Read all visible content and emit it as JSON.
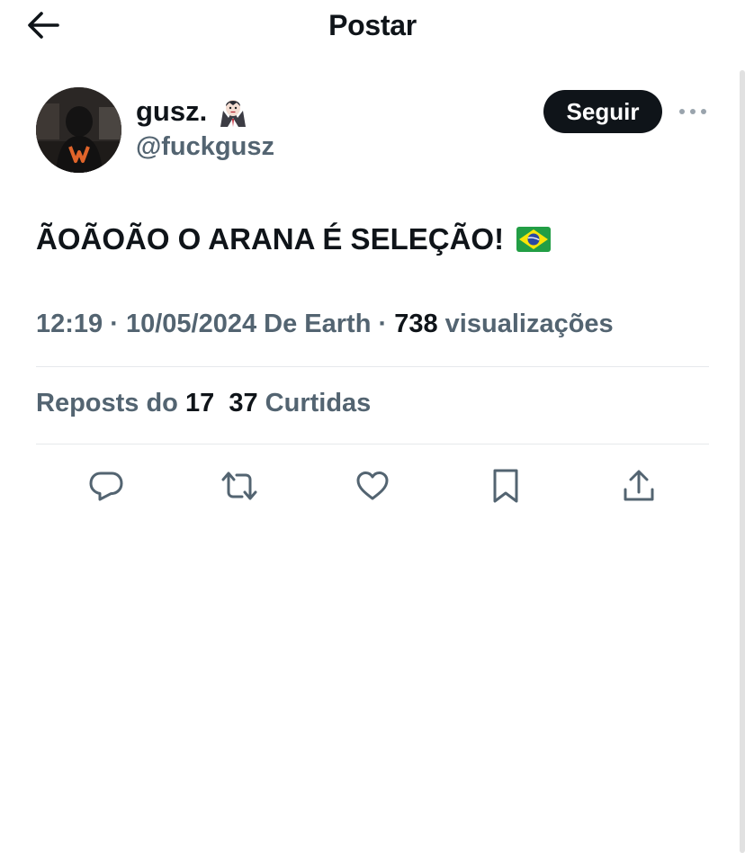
{
  "header": {
    "title": "Postar",
    "back_icon": "arrow-left-icon"
  },
  "author": {
    "display_name": "gusz.",
    "name_emoji": "vampire-emoji",
    "handle": "@fuckgusz",
    "follow_label": "Seguir",
    "more_icon": "more-horizontal-icon"
  },
  "post": {
    "text": "ÃOÃOÃO O ARANA É SELEÇÃO!",
    "trailing_emoji": "brazil-flag-emoji"
  },
  "meta": {
    "time": "12:19",
    "sep1": " · ",
    "date": "10/05/2024",
    "location": " De Earth",
    "sep2": " · ",
    "views_count": "738",
    "views_label": " visualizações"
  },
  "stats": {
    "reposts_label": "Reposts do ",
    "reposts_count": "17",
    "likes_count": "37",
    "likes_label": " Curtidas"
  },
  "actions": [
    {
      "icon": "reply-icon"
    },
    {
      "icon": "repost-icon"
    },
    {
      "icon": "like-icon"
    },
    {
      "icon": "bookmark-icon"
    },
    {
      "icon": "share-icon"
    }
  ],
  "colors": {
    "text": "#0f1419",
    "secondary": "#536471",
    "button_bg": "#0f1419",
    "button_text": "#ffffff",
    "divider": "#e6e9ec"
  }
}
